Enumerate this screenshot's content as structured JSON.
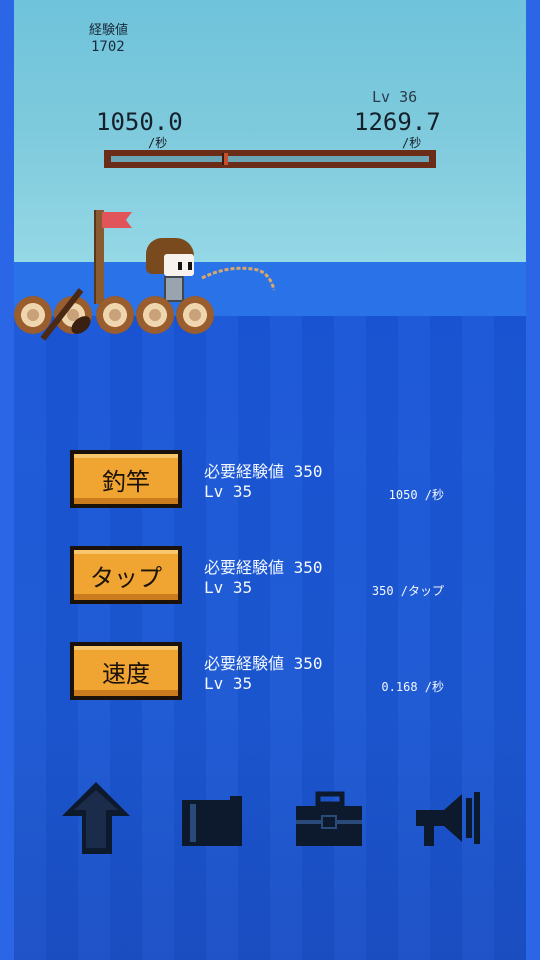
{
  "stats": {
    "exp_label": "経験値",
    "exp_value": "1702",
    "left_rate": "1050.0",
    "left_unit": "/秒",
    "right_rate": "1269.7",
    "right_unit": "/秒",
    "level": "Lv 36",
    "progress": 0.35
  },
  "upgrades": [
    {
      "label": "釣竿",
      "required": "必要経験値 350",
      "level": "Lv 35",
      "effect": "1050 /秒"
    },
    {
      "label": "タップ",
      "required": "必要経験値 350",
      "level": "Lv 35",
      "effect": "350 /タップ"
    },
    {
      "label": "速度",
      "required": "必要経験値 350",
      "level": "Lv 35",
      "effect": "0.168 /秒"
    }
  ],
  "nav": [
    "up-arrow-icon",
    "book-icon",
    "toolbox-icon",
    "megaphone-icon"
  ],
  "colors": {
    "sky": "#80cbdd",
    "sea": "#1a56d8",
    "button": "#f0a432",
    "bar_frame": "#6b2c18",
    "flag": "#e1545a"
  }
}
